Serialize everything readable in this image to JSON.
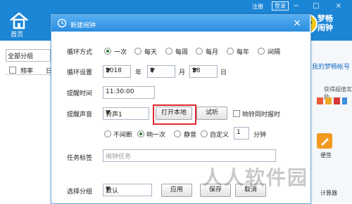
{
  "app": {
    "home_label": "首页",
    "register_link": "注册",
    "login_button": "登录",
    "logo_text_line1": "梦畅",
    "logo_text_line2": "闹钟",
    "window_controls": [
      "−",
      "□",
      "×"
    ]
  },
  "left_panel": {
    "group_select_value": "全部分组",
    "column_headers": [
      "频率",
      "日"
    ]
  },
  "right_panel": {
    "account_link": "我的梦畅帐号",
    "reward_text": "获得超值奖励",
    "note_label": "便签",
    "calculator_label": "计算器"
  },
  "dialog": {
    "title": "新建闹钟",
    "close_label": "×",
    "cycle": {
      "label": "循环方式",
      "options": [
        "一次",
        "每天",
        "每周",
        "每月",
        "每年",
        "间隔"
      ],
      "selected": "一次"
    },
    "cycle_settings": {
      "label": "循环设置",
      "year_value": "2018",
      "year_unit": "年",
      "month_value": "8",
      "month_unit": "月",
      "day_value": "28",
      "day_unit": "日"
    },
    "remind_time": {
      "label": "提醒时间",
      "value": "11:30:00"
    },
    "remind_sound": {
      "label": "提醒声音",
      "sound_value": "铃声1",
      "open_local_button": "打开本地",
      "preview_button": "试听",
      "sync_label": "响铃同时报时"
    },
    "ring_mode": {
      "options": [
        "不间断",
        "响一次",
        "静音",
        "自定义"
      ],
      "selected": "响一次",
      "custom_minutes_value": "1",
      "minutes_unit": "分钟"
    },
    "task_tag": {
      "label": "任务标签",
      "placeholder": "闹钟任务"
    },
    "group": {
      "label": "选择分组",
      "value": "默认",
      "apply_button": "应用",
      "save_button": "保存",
      "cancel_button": "取消"
    }
  },
  "watermark_text": "人人软件园",
  "colors": {
    "titlebar": "#1c86d6",
    "dialog_title": "#2b8de0",
    "highlight": "#e0262b",
    "radio_on": "#2a7a2a"
  }
}
